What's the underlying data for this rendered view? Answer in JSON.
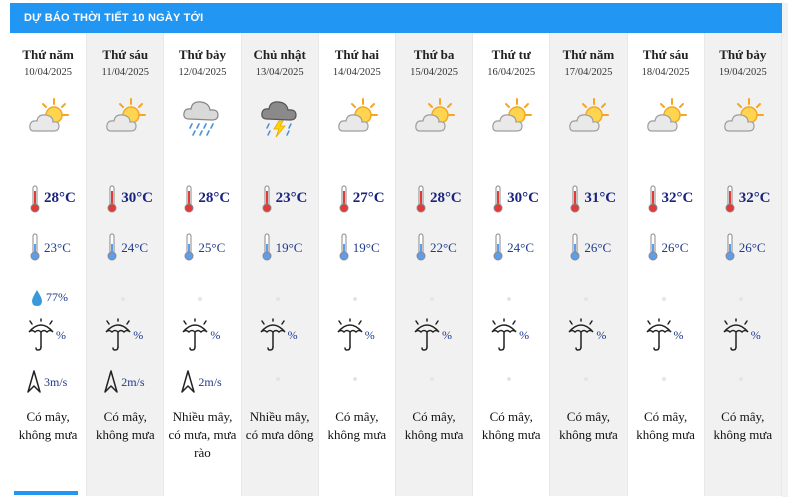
{
  "header": {
    "title": "DỰ BÁO THỜI TIẾT 10 NGÀY TỚI"
  },
  "colors": {
    "header_bg": "#2196f3",
    "temp_max": "#1a237e",
    "temp_min": "#1e3a8a",
    "active_underline": "#2196f3"
  },
  "days": [
    {
      "day": "Thứ năm",
      "date": "10/04/2025",
      "icon": "partly-cloudy-icon",
      "max": "28°C",
      "min": "23°C",
      "humidity": "77%",
      "rain": "%",
      "wind": "3m/s",
      "desc": [
        "Có mây,",
        "không mưa"
      ]
    },
    {
      "day": "Thứ sáu",
      "date": "11/04/2025",
      "icon": "partly-cloudy-icon",
      "max": "30°C",
      "min": "24°C",
      "humidity": "",
      "rain": "%",
      "wind": "2m/s",
      "desc": [
        "Có mây,",
        "không mưa"
      ]
    },
    {
      "day": "Thứ bảy",
      "date": "12/04/2025",
      "icon": "rain-cloud-icon",
      "max": "28°C",
      "min": "25°C",
      "humidity": "",
      "rain": "%",
      "wind": "2m/s",
      "desc": [
        "Nhiều mây,",
        "có mưa, mưa",
        "rào"
      ]
    },
    {
      "day": "Chủ nhật",
      "date": "13/04/2025",
      "icon": "thunderstorm-icon",
      "max": "23°C",
      "min": "19°C",
      "humidity": "",
      "rain": "%",
      "wind": "",
      "desc": [
        "Nhiều mây,",
        "có mưa dông"
      ]
    },
    {
      "day": "Thứ hai",
      "date": "14/04/2025",
      "icon": "partly-cloudy-icon",
      "max": "27°C",
      "min": "19°C",
      "humidity": "",
      "rain": "%",
      "wind": "",
      "desc": [
        "Có mây,",
        "không mưa"
      ]
    },
    {
      "day": "Thứ ba",
      "date": "15/04/2025",
      "icon": "partly-cloudy-icon",
      "max": "28°C",
      "min": "22°C",
      "humidity": "",
      "rain": "%",
      "wind": "",
      "desc": [
        "Có mây,",
        "không mưa"
      ]
    },
    {
      "day": "Thứ tư",
      "date": "16/04/2025",
      "icon": "partly-cloudy-icon",
      "max": "30°C",
      "min": "24°C",
      "humidity": "",
      "rain": "%",
      "wind": "",
      "desc": [
        "Có mây,",
        "không mưa"
      ]
    },
    {
      "day": "Thứ năm",
      "date": "17/04/2025",
      "icon": "partly-cloudy-icon",
      "max": "31°C",
      "min": "26°C",
      "humidity": "",
      "rain": "%",
      "wind": "",
      "desc": [
        "Có mây,",
        "không mưa"
      ]
    },
    {
      "day": "Thứ sáu",
      "date": "18/04/2025",
      "icon": "partly-cloudy-icon",
      "max": "32°C",
      "min": "26°C",
      "humidity": "",
      "rain": "%",
      "wind": "",
      "desc": [
        "Có mây,",
        "không mưa"
      ]
    },
    {
      "day": "Thứ bảy",
      "date": "19/04/2025",
      "icon": "partly-cloudy-icon",
      "max": "32°C",
      "min": "26°C",
      "humidity": "",
      "rain": "%",
      "wind": "",
      "desc": [
        "Có mây,",
        "không mưa"
      ]
    }
  ]
}
